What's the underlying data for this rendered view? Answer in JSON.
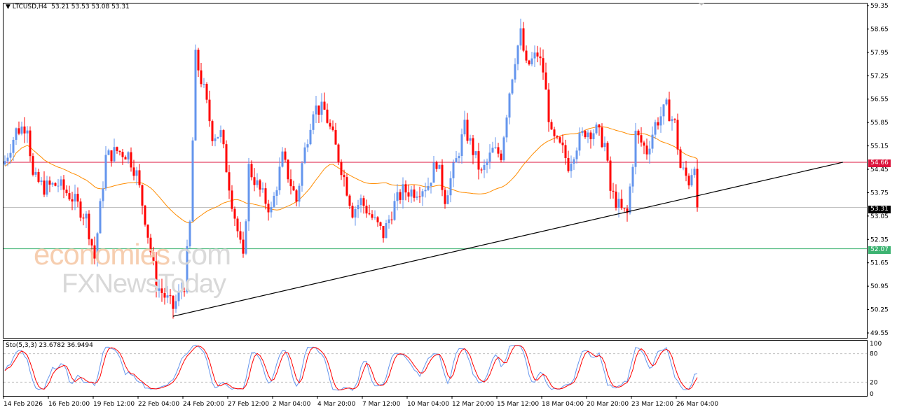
{
  "header": {
    "symbol": "LTCUSD,H4",
    "open": "53.21",
    "high": "53.53",
    "low": "53.08",
    "close": "53.31"
  },
  "stoch": {
    "label": "Sto(5,3,3)",
    "k": "23.6782",
    "d": "36.9494"
  },
  "watermark": {
    "line1a": "economies",
    "line1b": ".com",
    "line2": "FXNewsToday"
  },
  "price_axis": [
    "59.35",
    "58.65",
    "57.95",
    "57.25",
    "56.55",
    "55.85",
    "55.15",
    "54.45",
    "53.75",
    "53.05",
    "52.35",
    "51.65",
    "50.95",
    "50.25",
    "49.55"
  ],
  "stoch_axis": [
    "100",
    "80",
    "20",
    "0"
  ],
  "time_axis": [
    "14 Feb 2026",
    "16 Feb 20:00",
    "19 Feb 12:00",
    "22 Feb 04:00",
    "24 Feb 20:00",
    "27 Feb 12:00",
    "2 Mar 04:00",
    "4 Mar 20:00",
    "7 Mar 12:00",
    "10 Mar 04:00",
    "12 Mar 20:00",
    "15 Mar 12:00",
    "18 Mar 04:00",
    "20 Mar 20:00",
    "23 Mar 12:00",
    "26 Mar 04:00"
  ],
  "levels": {
    "resistance": {
      "label": "54.66",
      "value": 54.66,
      "color": "#dc143c"
    },
    "support": {
      "label": "52.07",
      "value": 52.07,
      "color": "#3cb371"
    },
    "current": {
      "label": "53.31",
      "value": 53.31,
      "color": "#000000"
    }
  },
  "trendline": {
    "from": [
      60,
      50.05
    ],
    "to": [
      299,
      54.66
    ]
  },
  "chart_data": {
    "type": "candlestick",
    "timeframe": "H4",
    "ylim": [
      49.55,
      59.35
    ],
    "up_color": "#6495ed",
    "down_color": "#ff0000",
    "ma_color": "#ff8c00",
    "price_path": [
      [
        0,
        54.7
      ],
      [
        4,
        55.6
      ],
      [
        8,
        55.8
      ],
      [
        10,
        54.2
      ],
      [
        14,
        53.9
      ],
      [
        19,
        54.0
      ],
      [
        24,
        53.6
      ],
      [
        29,
        53.0
      ],
      [
        32,
        51.8
      ],
      [
        36,
        54.8
      ],
      [
        40,
        55.0
      ],
      [
        44,
        54.9
      ],
      [
        47,
        54.3
      ],
      [
        50,
        53.0
      ],
      [
        54,
        51.0
      ],
      [
        60,
        50.3
      ],
      [
        64,
        51.0
      ],
      [
        66,
        52.8
      ],
      [
        68,
        57.8
      ],
      [
        71,
        56.8
      ],
      [
        74,
        55.5
      ],
      [
        77,
        55.5
      ],
      [
        81,
        53.5
      ],
      [
        85,
        51.7
      ],
      [
        87,
        54.5
      ],
      [
        91,
        53.8
      ],
      [
        95,
        53.2
      ],
      [
        99,
        54.8
      ],
      [
        104,
        53.5
      ],
      [
        106,
        54.6
      ],
      [
        110,
        56.3
      ],
      [
        114,
        56.2
      ],
      [
        117,
        55.4
      ],
      [
        121,
        54.2
      ],
      [
        124,
        53.2
      ],
      [
        127,
        53.5
      ],
      [
        131,
        53.0
      ],
      [
        135,
        52.5
      ],
      [
        139,
        53.4
      ],
      [
        142,
        53.8
      ],
      [
        146,
        53.8
      ],
      [
        151,
        54.0
      ],
      [
        154,
        54.7
      ],
      [
        157,
        53.6
      ],
      [
        161,
        54.7
      ],
      [
        164,
        55.7
      ],
      [
        167,
        55.0
      ],
      [
        170,
        54.3
      ],
      [
        174,
        55.0
      ],
      [
        177,
        54.9
      ],
      [
        180,
        56.8
      ],
      [
        182,
        57.8
      ],
      [
        184,
        58.5
      ],
      [
        186,
        57.5
      ],
      [
        190,
        57.9
      ],
      [
        192,
        57.4
      ],
      [
        195,
        55.4
      ],
      [
        199,
        55.0
      ],
      [
        201,
        54.6
      ],
      [
        204,
        55.2
      ],
      [
        207,
        55.6
      ],
      [
        211,
        55.6
      ],
      [
        214,
        55.2
      ],
      [
        216,
        53.8
      ],
      [
        220,
        53.2
      ],
      [
        222,
        53.1
      ],
      [
        225,
        55.5
      ],
      [
        229,
        55.0
      ],
      [
        232,
        55.8
      ],
      [
        236,
        56.3
      ],
      [
        239,
        55.8
      ],
      [
        241,
        54.5
      ],
      [
        244,
        54.1
      ],
      [
        246,
        54.7
      ],
      [
        247,
        53.31
      ]
    ]
  }
}
